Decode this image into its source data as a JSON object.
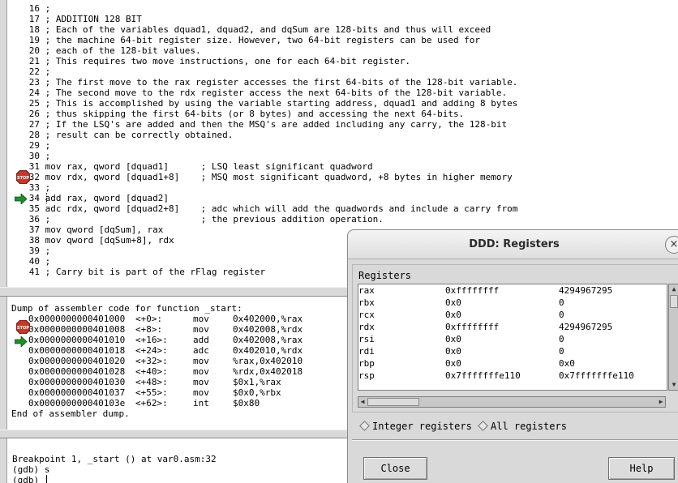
{
  "source": {
    "lines": [
      {
        "num": "16",
        "text": ";"
      },
      {
        "num": "17",
        "text": "; ADDITION 128 BIT"
      },
      {
        "num": "18",
        "text": "; Each of the variables dquad1, dquad2, and dqSum are 128-bits and thus will exceed"
      },
      {
        "num": "19",
        "text": "; the machine 64-bit register size. However, two 64-bit registers can be used for"
      },
      {
        "num": "20",
        "text": "; each of the 128-bit values."
      },
      {
        "num": "21",
        "text": "; This requires two move instructions, one for each 64-bit register."
      },
      {
        "num": "22",
        "text": ";"
      },
      {
        "num": "23",
        "text": "; The first move to the rax register accesses the first 64-bits of the 128-bit variable."
      },
      {
        "num": "24",
        "text": "; The second move to the rdx register access the next 64-bits of the 128-bit variable."
      },
      {
        "num": "25",
        "text": "; This is accomplished by using the variable starting address, dquad1 and adding 8 bytes"
      },
      {
        "num": "26",
        "text": "; thus skipping the first 64-bits (or 8 bytes) and accessing the next 64-bits."
      },
      {
        "num": "27",
        "text": "; If the LSQ's are added and then the MSQ's are added including any carry, the 128-bit"
      },
      {
        "num": "28",
        "text": "; result can be correctly obtained."
      },
      {
        "num": "29",
        "text": ";"
      },
      {
        "num": "30",
        "text": ";"
      },
      {
        "num": "31",
        "text": "mov rax, qword [dquad1]      ; LSQ least significant quadword"
      },
      {
        "num": "32",
        "text": "mov rdx, qword [dquad1+8]    ; MSQ most significant quadword, +8 bytes in higher memory"
      },
      {
        "num": "33",
        "text": ";"
      },
      {
        "num": "34",
        "text": "add rax, qword [dquad2]"
      },
      {
        "num": "35",
        "text": "adc rdx, qword [dquad2+8]    ; adc which will add the quadwords and include a carry from"
      },
      {
        "num": "36",
        "text": ";                            ; the previous addition operation."
      },
      {
        "num": "37",
        "text": "mov qword [dqSum], rax"
      },
      {
        "num": "38",
        "text": "mov qword [dqSum+8], rdx"
      },
      {
        "num": "39",
        "text": ";"
      },
      {
        "num": "40",
        "text": ";"
      },
      {
        "num": "41",
        "text": "; Carry bit is part of the rFlag register"
      }
    ]
  },
  "machine": {
    "header": "Dump of assembler code for function _start:",
    "rows": [
      {
        "addr": "0x0000000000401000",
        "off": "<+0>:",
        "op": "mov",
        "args": "0x402000,%rax"
      },
      {
        "addr": "0x0000000000401008",
        "off": "<+8>:",
        "op": "mov",
        "args": "0x402008,%rdx"
      },
      {
        "addr": "0x0000000000401010",
        "off": "<+16>:",
        "op": "add",
        "args": "0x402008,%rax"
      },
      {
        "addr": "0x0000000000401018",
        "off": "<+24>:",
        "op": "adc",
        "args": "0x402010,%rdx"
      },
      {
        "addr": "0x0000000000401020",
        "off": "<+32>:",
        "op": "mov",
        "args": "%rax,0x402010"
      },
      {
        "addr": "0x0000000000401028",
        "off": "<+40>:",
        "op": "mov",
        "args": "%rdx,0x402018"
      },
      {
        "addr": "0x0000000000401030",
        "off": "<+48>:",
        "op": "mov",
        "args": "$0x1,%rax"
      },
      {
        "addr": "0x0000000000401037",
        "off": "<+55>:",
        "op": "mov",
        "args": "$0x0,%rbx"
      },
      {
        "addr": "0x000000000040103e",
        "off": "<+62>:",
        "op": "int",
        "args": "$0x80"
      }
    ],
    "footer": "End of assembler dump."
  },
  "console": {
    "lines": [
      "Breakpoint 1, _start () at var0.asm:32",
      "(gdb) s",
      "(gdb) "
    ]
  },
  "registers_dialog": {
    "title": "DDD: Registers",
    "close_glyph": "×",
    "group_label": "Registers",
    "rows": [
      {
        "name": "rax",
        "hex": "0xffffffff",
        "value": "4294967295"
      },
      {
        "name": "rbx",
        "hex": "0x0",
        "value": "0"
      },
      {
        "name": "rcx",
        "hex": "0x0",
        "value": "0"
      },
      {
        "name": "rdx",
        "hex": "0xffffffff",
        "value": "4294967295"
      },
      {
        "name": "rsi",
        "hex": "0x0",
        "value": "0"
      },
      {
        "name": "rdi",
        "hex": "0x0",
        "value": "0"
      },
      {
        "name": "rbp",
        "hex": "0x0",
        "value": "0x0"
      },
      {
        "name": "rsp",
        "hex": "0x7fffffffe110",
        "value": "0x7fffffffe110"
      }
    ],
    "radio_integer": "Integer registers",
    "radio_all": "All registers",
    "close_button": "Close",
    "help_button": "Help"
  },
  "icons": {
    "breakpoint": "stop-sign-icon",
    "program_counter": "green-arrow-icon"
  },
  "colors": {
    "stop_sign": "#c0392b",
    "pc_arrow": "#1f8f2a"
  }
}
